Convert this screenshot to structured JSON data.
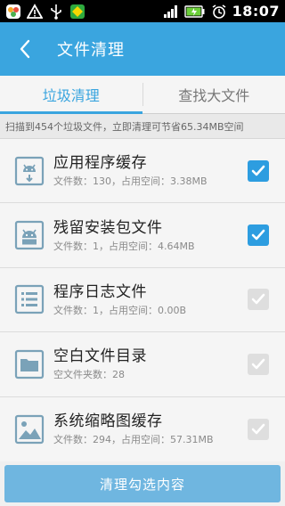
{
  "status_bar": {
    "time": "18:07",
    "icons": [
      "app-notification-icon",
      "warning-icon",
      "usb-icon",
      "green-app-icon",
      "signal-icon",
      "battery-icon",
      "alarm-icon"
    ]
  },
  "header": {
    "title": "文件清理",
    "accent_color": "#3aa5df"
  },
  "tabs": [
    {
      "label": "垃圾清理",
      "active": true
    },
    {
      "label": "查找大文件",
      "active": false
    }
  ],
  "info": {
    "text": "扫描到454个垃圾文件，立即清理可节省65.34MB空间"
  },
  "items": [
    {
      "title": "应用程序缓存",
      "detail": "文件数：130，占用空间：3.38MB",
      "icon": "android-cache-icon",
      "checked": true,
      "enabled": true
    },
    {
      "title": "残留安装包文件",
      "detail": "文件数：1，占用空间：4.64MB",
      "icon": "android-apk-icon",
      "checked": true,
      "enabled": true
    },
    {
      "title": "程序日志文件",
      "detail": "文件数：1，占用空间：0.00B",
      "icon": "log-list-icon",
      "checked": true,
      "enabled": false
    },
    {
      "title": "空白文件目录",
      "detail": "空文件夹数：28",
      "icon": "folder-icon",
      "checked": true,
      "enabled": false
    },
    {
      "title": "系统缩略图缓存",
      "detail": "文件数：294，占用空间：57.31MB",
      "icon": "image-thumbnail-icon",
      "checked": true,
      "enabled": false
    }
  ],
  "action": {
    "label": "清理勾选内容"
  }
}
